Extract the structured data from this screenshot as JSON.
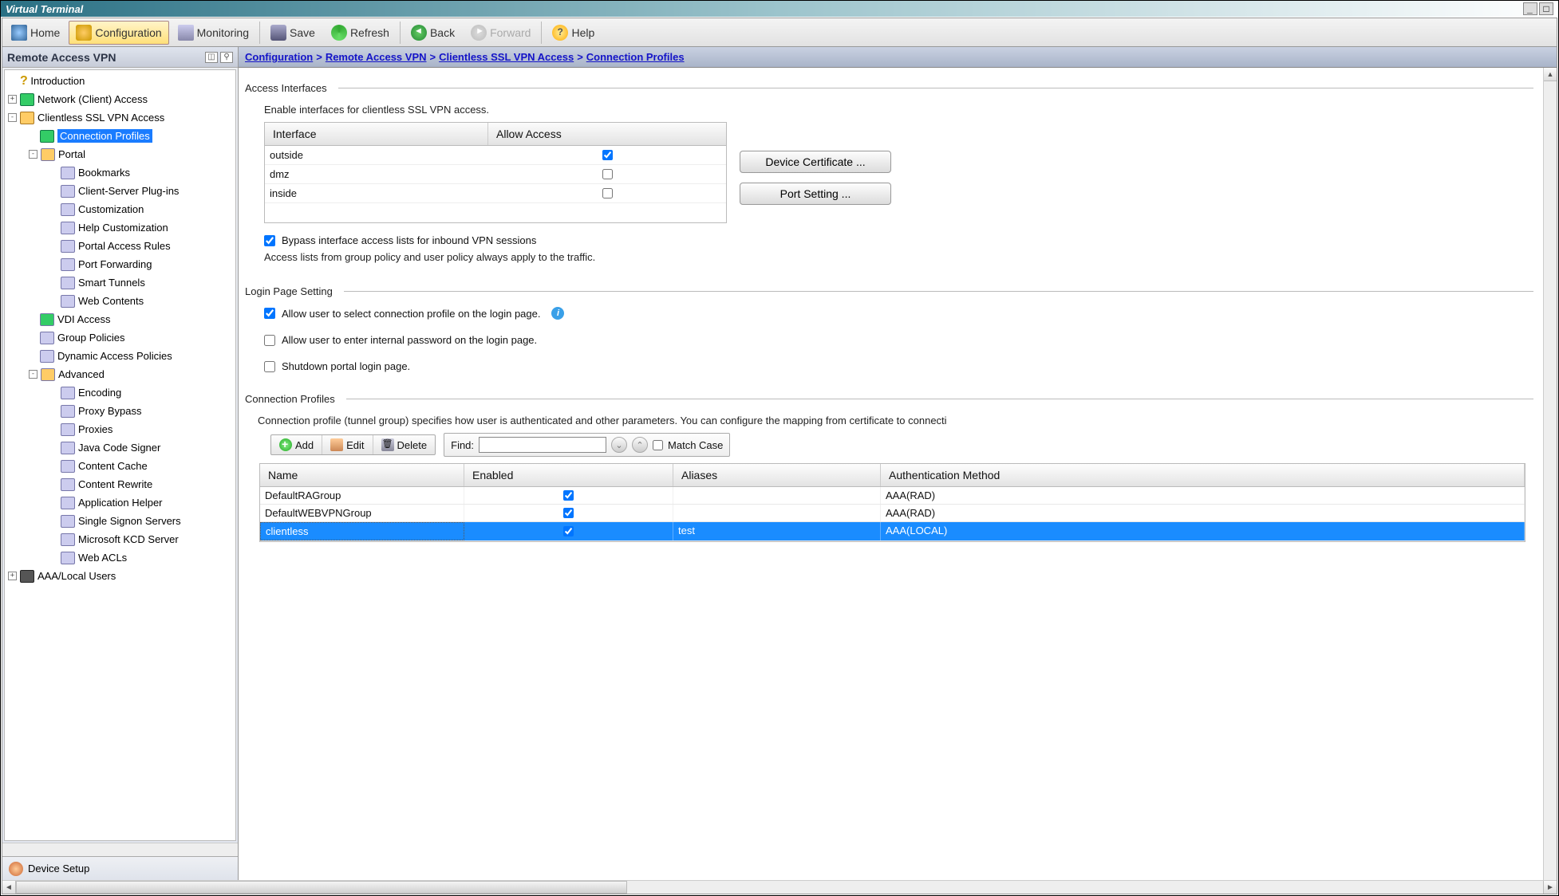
{
  "window": {
    "title": "Virtual Terminal"
  },
  "toolbar": {
    "home": "Home",
    "configuration": "Configuration",
    "monitoring": "Monitoring",
    "save": "Save",
    "refresh": "Refresh",
    "back": "Back",
    "forward": "Forward",
    "help": "Help"
  },
  "sidebar": {
    "title": "Remote Access VPN",
    "items": [
      "Introduction",
      "Network (Client) Access",
      "Clientless SSL VPN Access",
      "Connection Profiles",
      "Portal",
      "Bookmarks",
      "Client-Server Plug-ins",
      "Customization",
      "Help Customization",
      "Portal Access Rules",
      "Port Forwarding",
      "Smart Tunnels",
      "Web Contents",
      "VDI Access",
      "Group Policies",
      "Dynamic Access Policies",
      "Advanced",
      "Encoding",
      "Proxy Bypass",
      "Proxies",
      "Java Code Signer",
      "Content Cache",
      "Content Rewrite",
      "Application Helper",
      "Single Signon Servers",
      "Microsoft KCD Server",
      "Web ACLs",
      "AAA/Local Users"
    ],
    "tail": "Device Setup"
  },
  "breadcrumb": {
    "p1": "Configuration",
    "p2": "Remote Access VPN",
    "p3": "Clientless SSL VPN Access",
    "p4": "Connection Profiles"
  },
  "access_interfaces": {
    "title": "Access Interfaces",
    "note": "Enable interfaces for clientless SSL VPN access.",
    "col_iface": "Interface",
    "col_allow": "Allow Access",
    "rows": [
      {
        "name": "outside",
        "allow": true
      },
      {
        "name": "dmz",
        "allow": false
      },
      {
        "name": "inside",
        "allow": false
      }
    ],
    "btn_device_cert": "Device Certificate ...",
    "btn_port_setting": "Port Setting ...",
    "bypass_label": "Bypass interface access lists for inbound VPN sessions",
    "bypass_checked": true,
    "note2": "Access lists from group policy and user policy always apply to the traffic."
  },
  "login_page": {
    "title": "Login Page Setting",
    "opt1": "Allow user to select connection profile on the login page.",
    "opt1_checked": true,
    "opt2": "Allow user to enter internal password on the login page.",
    "opt2_checked": false,
    "opt3": "Shutdown portal login page.",
    "opt3_checked": false
  },
  "conn_profiles": {
    "title": "Connection Profiles",
    "desc": "Connection profile (tunnel group) specifies how user is authenticated and other parameters. You can configure the mapping from certificate to connecti",
    "btn_add": "Add",
    "btn_edit": "Edit",
    "btn_delete": "Delete",
    "find_label": "Find:",
    "find_value": "",
    "match_case": "Match Case",
    "col_name": "Name",
    "col_enabled": "Enabled",
    "col_aliases": "Aliases",
    "col_auth": "Authentication Method",
    "rows": [
      {
        "name": "DefaultRAGroup",
        "enabled": true,
        "aliases": "",
        "auth": "AAA(RAD)"
      },
      {
        "name": "DefaultWEBVPNGroup",
        "enabled": true,
        "aliases": "",
        "auth": "AAA(RAD)"
      },
      {
        "name": "clientless",
        "enabled": true,
        "aliases": "test",
        "auth": "AAA(LOCAL)"
      }
    ]
  }
}
